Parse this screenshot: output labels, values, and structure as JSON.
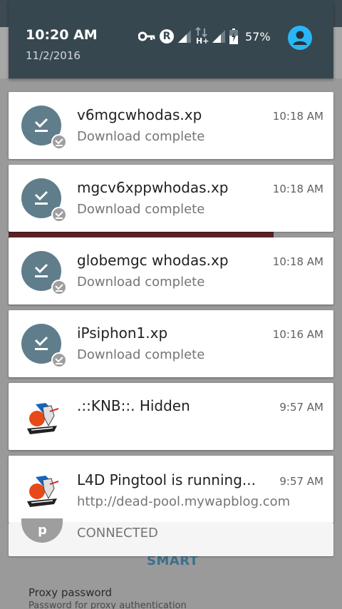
{
  "status_bar": {
    "time": "10:20 AM",
    "date": "11/2/2016",
    "battery": "57%",
    "network_type": "H+",
    "roaming_letter": "R"
  },
  "notifications": [
    {
      "title": "v6mgcwhodas.xp",
      "text": "Download complete",
      "time": "10:18 AM",
      "icon": "download-complete-icon"
    },
    {
      "title": "mgcv6xppwhodas.xp",
      "text": "Download complete",
      "time": "10:18 AM",
      "icon": "download-complete-icon"
    },
    {
      "title": "globemgc whodas.xp",
      "text": "Download complete",
      "time": "10:18 AM",
      "icon": "download-complete-icon"
    },
    {
      "title": "iPsiphon1.xp",
      "text": "Download complete",
      "time": "10:16 AM",
      "icon": "download-complete-icon"
    },
    {
      "title": ".::KNB::. Hidden",
      "text": "",
      "time": "9:57 AM",
      "icon": "app-logo-icon"
    },
    {
      "title": "L4D Pingtool is running...",
      "text": "http://dead-pool.mywapblog.com",
      "time": "9:57 AM",
      "icon": "app-logo-icon"
    }
  ],
  "background": {
    "connected": "CONNECTED",
    "smart": "SMART",
    "proxy_password_title": "Proxy password",
    "proxy_password_sub": "Password for proxy authentication"
  },
  "colors": {
    "header_bg": "#37474f",
    "icon_bg": "#607d8b",
    "avatar": "#29b6f6"
  }
}
